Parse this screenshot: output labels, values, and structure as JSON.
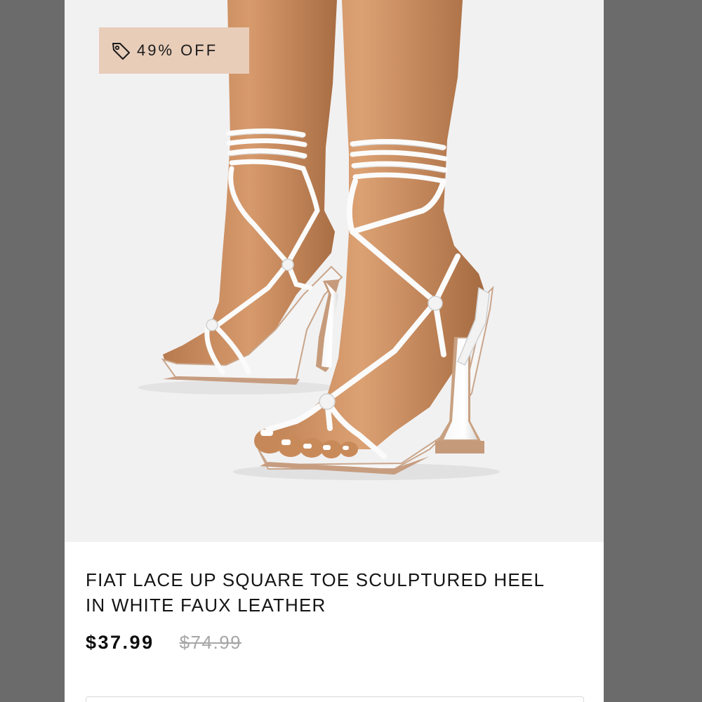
{
  "product": {
    "discount_badge": "49% OFF",
    "badge_icon": "price-tag-icon",
    "title_line1": "FIAT LACE UP SQUARE TOE SCULPTURED HEEL",
    "title_line2": "IN WHITE FAUX LEATHER",
    "price_current": "$37.99",
    "price_original": "$74.99"
  },
  "colors": {
    "badge_background": "#e8cdb9",
    "page_background": "#ffffff",
    "photo_background": "#f1f1f2",
    "outer_background": "#6b6b6b",
    "original_price": "#a7a7a7"
  }
}
